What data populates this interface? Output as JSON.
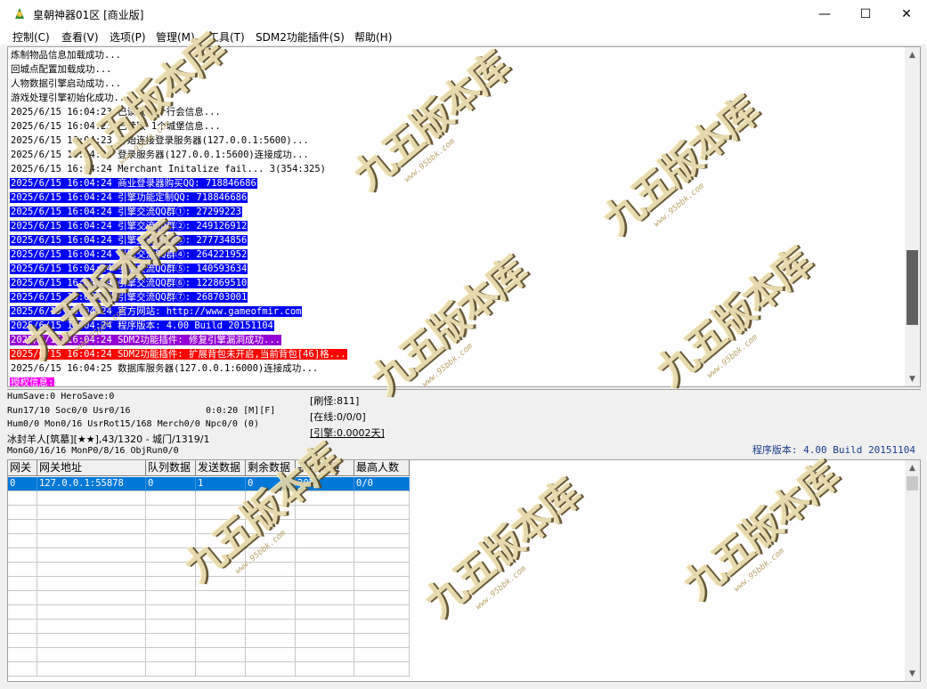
{
  "window": {
    "title": "皇朝神器01区 [商业版]",
    "controls": {
      "minimize": "—",
      "maximize": "☐",
      "close": "✕"
    }
  },
  "menu": [
    "控制(C)",
    "查看(V)",
    "选项(P)",
    "管理(M)",
    "工具(T)",
    "SDM2功能插件(S)",
    "帮助(H)"
  ],
  "log": [
    {
      "text": "炼制物品信息加载成功...",
      "bg": "",
      "fg": "#000000"
    },
    {
      "text": "回城点配置加载成功...",
      "bg": "",
      "fg": "#000000"
    },
    {
      "text": "人物数据引擎启动成功...",
      "bg": "",
      "fg": "#000000"
    },
    {
      "text": "游戏处理引擎初始化成功...",
      "bg": "",
      "fg": "#000000"
    },
    {
      "text": "2025/6/15 16:04:23 已读取 0个行会信息...",
      "bg": "",
      "fg": "#000000"
    },
    {
      "text": "2025/6/15 16:04:23 已读取 1个城堡信息...",
      "bg": "",
      "fg": "#000000"
    },
    {
      "text": "2025/6/15 16:04:23 开始连接登录服务器(127.0.0.1:5600)...",
      "bg": "",
      "fg": "#000000"
    },
    {
      "text": "2025/6/15 16:04:24 登录服务器(127.0.0.1:5600)连接成功...",
      "bg": "",
      "fg": "#000000"
    },
    {
      "text": "2025/6/15 16:04:24 Merchant Initalize fail...  3(354:325)",
      "bg": "",
      "fg": "#000000"
    },
    {
      "text": "2025/6/15 16:04:24 商业登录器购买QQ: 718846686",
      "bg": "#0000ff",
      "fg": "#ffffff"
    },
    {
      "text": "2025/6/15 16:04:24 引擎功能定制QQ: 718846686",
      "bg": "#0000ff",
      "fg": "#ffffff"
    },
    {
      "text": "2025/6/15 16:04:24 引擎交流QQ群①: 27299223",
      "bg": "#0000ff",
      "fg": "#ffffff"
    },
    {
      "text": "2025/6/15 16:04:24 引擎交流QQ群②: 249126912",
      "bg": "#0000ff",
      "fg": "#ffffff"
    },
    {
      "text": "2025/6/15 16:04:24 引擎交流QQ群③: 277734856",
      "bg": "#0000ff",
      "fg": "#ffffff"
    },
    {
      "text": "2025/6/15 16:04:24 引擎交流QQ群④: 264221952",
      "bg": "#0000ff",
      "fg": "#ffffff"
    },
    {
      "text": "2025/6/15 16:04:24 引擎交流QQ群⑤: 140593634",
      "bg": "#0000ff",
      "fg": "#ffffff"
    },
    {
      "text": "2025/6/15 16:04:24 引擎交流QQ群⑥: 122869510",
      "bg": "#0000ff",
      "fg": "#ffffff"
    },
    {
      "text": "2025/6/15 16:04:24 引擎交流QQ群⑦: 268703001",
      "bg": "#0000ff",
      "fg": "#ffffff"
    },
    {
      "text": "2025/6/15 16:04:24 官方网站: http://www.gameofmir.com",
      "bg": "#0000ff",
      "fg": "#ffffff"
    },
    {
      "text": "2025/6/15 16:04:24 程序版本: 4.00 Build 20151104",
      "bg": "#0000ff",
      "fg": "#ffffff"
    },
    {
      "text": "2025/6/15 16:04:24 SDM2功能插件: 修复引擎漏洞成功...",
      "bg": "#9400d3",
      "fg": "#ffffff"
    },
    {
      "text": "2025/6/15 16:04:24 SDM2功能插件: 扩展背包未开启,当前背包[46]格...",
      "bg": "#ff0000",
      "fg": "#ffffff"
    },
    {
      "text": "2025/6/15 16:04:25 数据库服务器(127.0.0.1:6000)连接成功...",
      "bg": "",
      "fg": "#000000"
    },
    {
      "text": "授权信息:",
      "bg": "#ff00ff",
      "fg": "#ffffff"
    }
  ],
  "status": {
    "line1": "HumSave:0 HeroSave:0",
    "line2": "Run17/10 Soc0/0 Usr0/16",
    "timer": "0:0:20 [M][F]",
    "line3": "Hum0/0 Mon0/16 UsrRot15/168 Merch0/0 Npc0/0 (0)",
    "line4": "冰封羊人[筑墓][★★],43/1320 - 城门/1319/1",
    "line5": "MonG0/16/16 MonP0/8/16 ObjRun0/0",
    "refresh": "[刷怪:811]",
    "online": "[在线:0/0/0]",
    "engine": "[引擎:0.0002天]",
    "version": "程序版本: 4.00 Build 20151104"
  },
  "gateway_table": {
    "headers": [
      "网关",
      "网关地址",
      "队列数据",
      "发送数据",
      "剩余数据",
      "平均流量",
      "最高人数"
    ],
    "rows": [
      [
        "0",
        "127.0.0.1:55878",
        "0",
        "1",
        "0",
        "205",
        "0/0"
      ]
    ]
  },
  "watermark": {
    "main": "九五版本库",
    "sub": "www.95bbk.com"
  },
  "colors": {
    "selection": "#0078d7",
    "version_text": "#1a3c8c",
    "scroll_thumb": "#606060"
  }
}
